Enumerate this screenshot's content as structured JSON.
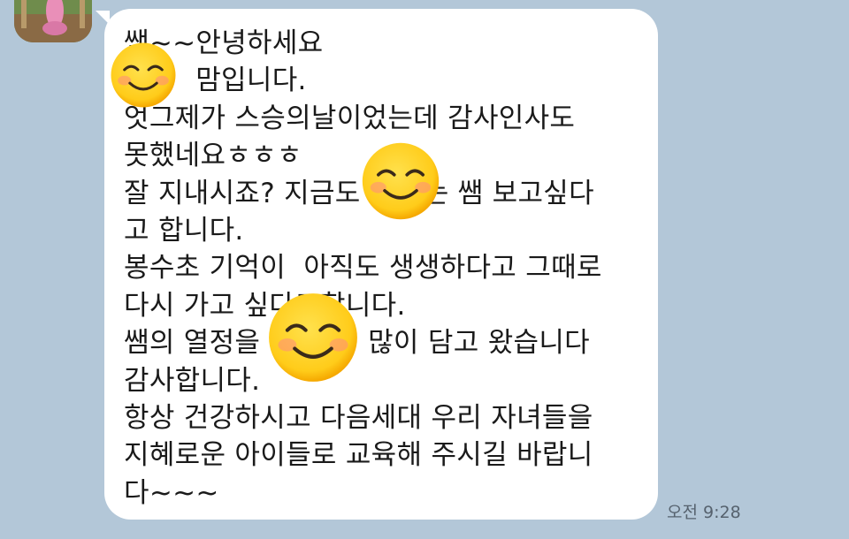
{
  "message": {
    "lines": [
      "쌤~~안녕하세요",
      "        맘입니다.",
      "엇그제가 스승의날이었는데 감사인사도",
      "못했네요ㅎㅎㅎ",
      "잘 지내시죠? 지금도       는 쌤 보고싶다",
      "고 합니다.",
      "봉수초 기억이  아직도 생생하다고 그때로",
      "다시 가고 싶다고합니다.",
      "쌤의 열정을            많이 담고 왔습니다",
      "감사합니다.",
      "항상 건강하시고 다음세대 우리 자녀들을",
      "지혜로운 아이들로 교육해 주시길 바랍니",
      "다~~~"
    ],
    "timestamp": "오전 9:28"
  },
  "emoji": {
    "name": "smiling-face-emoji",
    "face_color": "#ffd633",
    "edge_color": "#f5a800",
    "cheek_color": "#ff8a80"
  },
  "colors": {
    "background": "#b3c7d8",
    "bubble": "#ffffff",
    "text": "#1a1a1a",
    "timestamp": "#56626e"
  }
}
